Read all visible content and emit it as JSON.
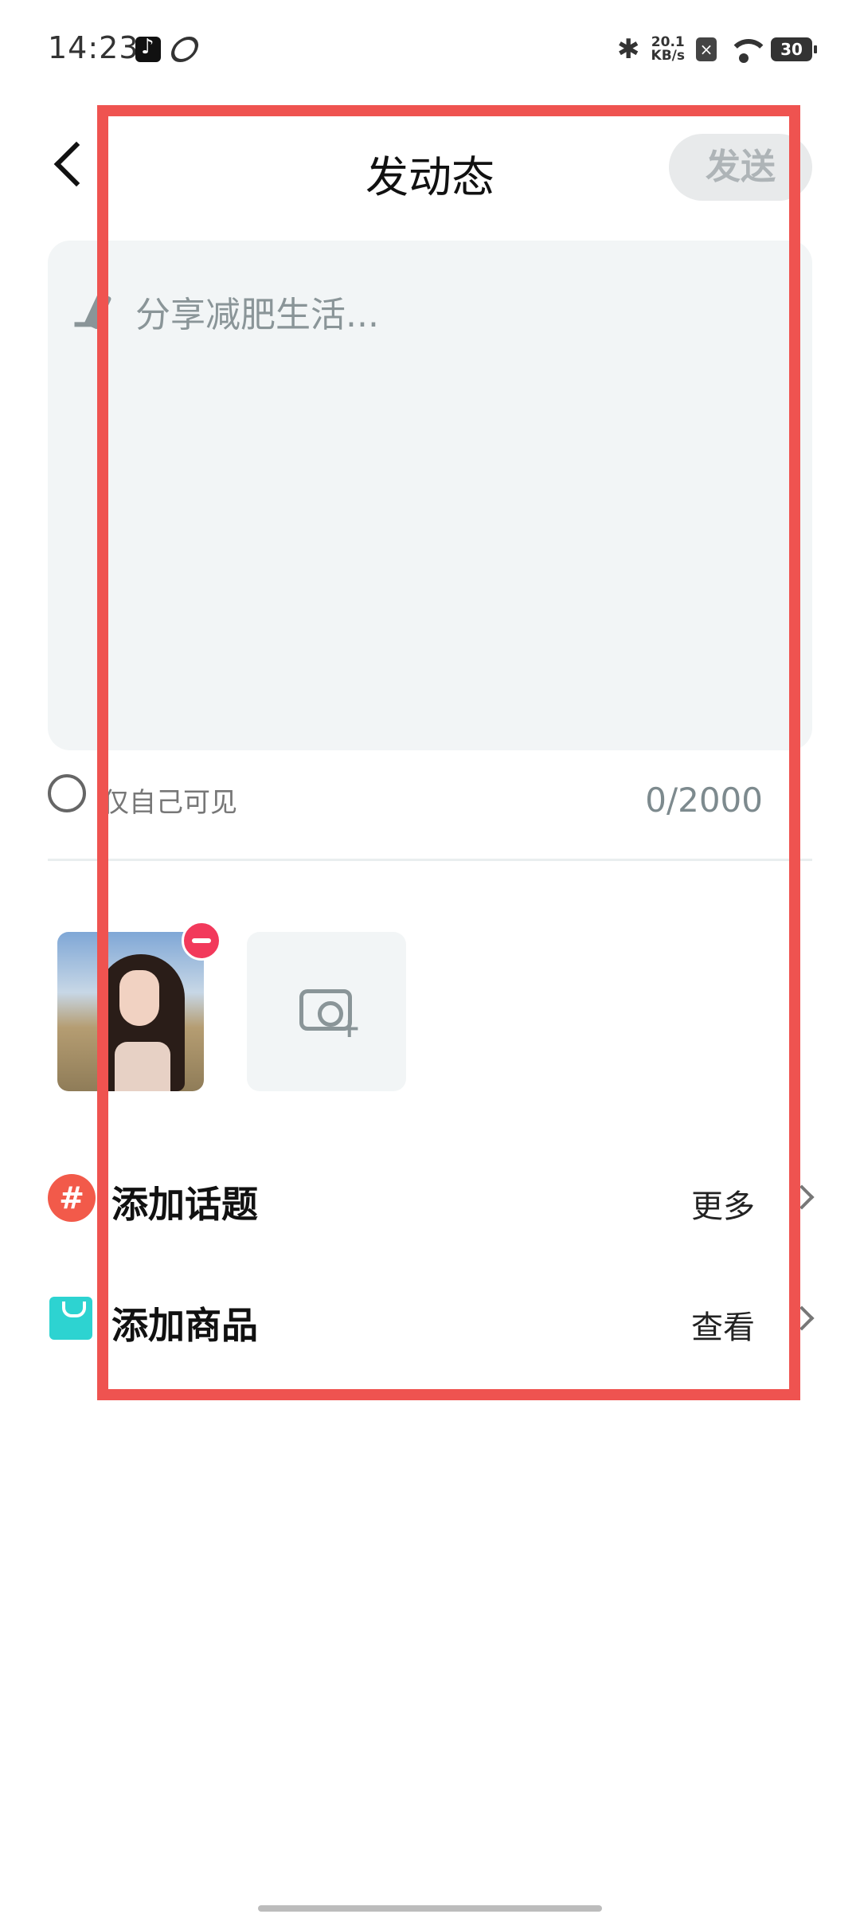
{
  "status_bar": {
    "time": "14:23",
    "net_speed_value": "20.1",
    "net_speed_unit": "KB/s",
    "battery": "30",
    "icons": [
      "tiktok-icon",
      "sync-icon",
      "bluetooth-icon",
      "sim-off-icon",
      "wifi-icon",
      "battery-icon"
    ]
  },
  "header": {
    "title": "发动态",
    "send_label": "发送"
  },
  "editor": {
    "placeholder": "分享减肥生活..."
  },
  "visibility": {
    "label": "仅自己可见",
    "checked": false
  },
  "char_count": "0/2000",
  "media": {
    "photos": [
      {
        "subject": "photo-thumbnail"
      }
    ],
    "add_icon": "camera-plus-icon"
  },
  "actions": {
    "topic": {
      "label": "添加话题",
      "action": "更多"
    },
    "goods": {
      "label": "添加商品",
      "action": "查看"
    }
  },
  "colors": {
    "annotation": "#ef5350",
    "send_disabled_bg": "#e8eaeb",
    "editor_bg": "#f2f5f6",
    "remove_badge": "#f2395b",
    "topic_icon": "#f25a4a",
    "goods_icon": "#2dd3d1"
  }
}
